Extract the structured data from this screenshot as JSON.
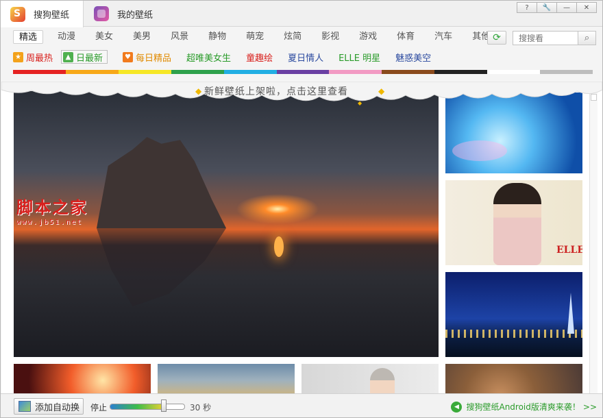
{
  "tabs": [
    {
      "label": "搜狗壁纸",
      "icon": "sogou-logo-icon"
    },
    {
      "label": "我的壁纸",
      "icon": "my-wallpaper-icon"
    }
  ],
  "window_controls": [
    "?",
    "🔧",
    "—",
    "✕"
  ],
  "categories": [
    "精选",
    "动漫",
    "美女",
    "美男",
    "风景",
    "静物",
    "萌宠",
    "炫简",
    "影视",
    "游戏",
    "体育",
    "汽车",
    "其他"
  ],
  "search": {
    "placeholder": "搜搜看"
  },
  "featured": [
    {
      "label": "周最热",
      "color": "#d8201d",
      "icon": "star-icon"
    },
    {
      "label": "日最新",
      "color": "#2a9b2a",
      "icon": "picture-icon"
    },
    {
      "label": "每日精品",
      "color": "#e08a00",
      "icon": "heart-icon"
    },
    {
      "label": "超唯美女生",
      "color": "#2a9b2a"
    },
    {
      "label": "童趣绘",
      "color": "#d8201d"
    },
    {
      "label": "夏日情人",
      "color": "#2b4a9f"
    },
    {
      "label": "ELLE 明星",
      "color": "#2a9b2a"
    },
    {
      "label": "魅惑美空",
      "color": "#2b4a9f"
    }
  ],
  "color_filter": [
    "#e52222",
    "#f7a818",
    "#f6e726",
    "#2ea14b",
    "#21aee3",
    "#6a3fa3",
    "#f29ac3",
    "#8a4a1c",
    "#222222",
    "#ffffff",
    "#bdbdbd"
  ],
  "notice": "新鲜壁纸上架啦，点击这里查看",
  "watermark": {
    "line1": "脚本之家",
    "line2": "www.jb51.net"
  },
  "wallpapers": {
    "side2_brand": "ELLE"
  },
  "footer": {
    "auto_change_label": "添加自动换",
    "stop_label": "停止",
    "interval_label": "30 秒",
    "interval_fraction": 0.72,
    "promo_text": "搜狗壁纸Android版清爽来袭！",
    "promo_arrows": ">>"
  }
}
